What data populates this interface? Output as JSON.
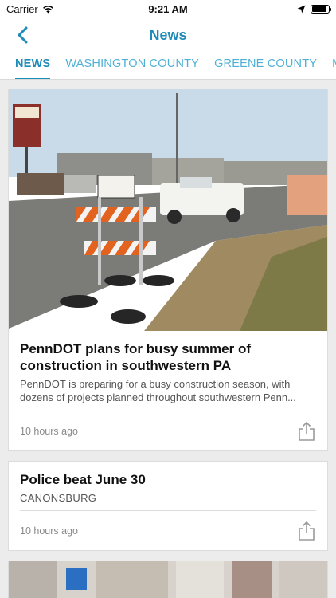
{
  "status": {
    "carrier": "Carrier",
    "time": "9:21 AM",
    "battery_level": 0.9
  },
  "nav": {
    "title": "News",
    "back_icon": "chevron-left-icon"
  },
  "tabs": [
    {
      "label": "NEWS",
      "active": true
    },
    {
      "label": "WASHINGTON COUNTY",
      "active": false
    },
    {
      "label": "GREENE COUNTY",
      "active": false
    },
    {
      "label": "MO",
      "active": false
    }
  ],
  "articles": [
    {
      "title": "PennDOT plans for busy summer of construction in southwestern PA",
      "excerpt": "PennDOT is preparing for a busy construction season, with dozens of projects planned throughout southwestern Penn...",
      "time": "10 hours ago"
    },
    {
      "title": "Police beat June 30",
      "location": "CANONSBURG",
      "time": "10 hours ago"
    }
  ],
  "colors": {
    "accent": "#1f8bb8",
    "tab_inactive": "#4fb0d6",
    "background": "#ececec"
  }
}
